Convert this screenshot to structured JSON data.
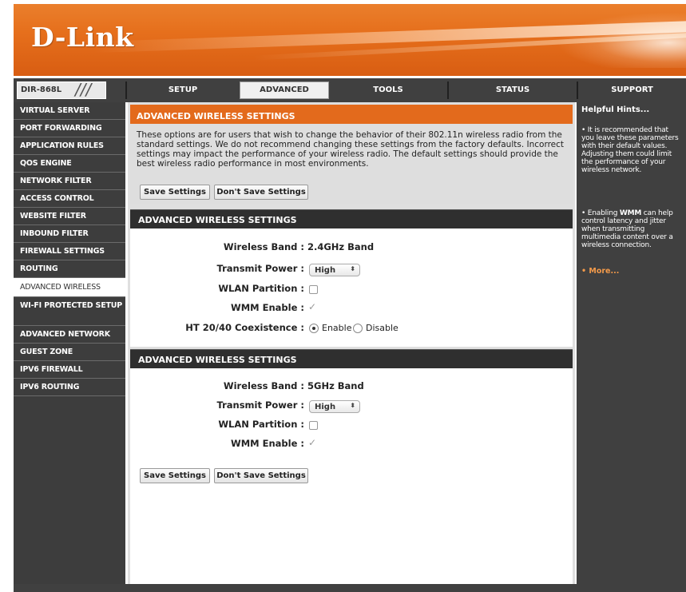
{
  "brand": {
    "logo_text": "D-Link"
  },
  "model": {
    "label": "DIR-868L",
    "slashes": "///"
  },
  "tabs": [
    {
      "label": "SETUP",
      "active": false
    },
    {
      "label": "ADVANCED",
      "active": true
    },
    {
      "label": "TOOLS",
      "active": false
    },
    {
      "label": "STATUS",
      "active": false
    },
    {
      "label": "SUPPORT",
      "active": false
    }
  ],
  "sidebar": {
    "items": [
      {
        "label": "VIRTUAL SERVER"
      },
      {
        "label": "PORT FORWARDING"
      },
      {
        "label": "APPLICATION RULES"
      },
      {
        "label": "QOS ENGINE"
      },
      {
        "label": "NETWORK FILTER"
      },
      {
        "label": "ACCESS CONTROL"
      },
      {
        "label": "WEBSITE FILTER"
      },
      {
        "label": "INBOUND FILTER"
      },
      {
        "label": "FIREWALL SETTINGS"
      },
      {
        "label": "ROUTING"
      },
      {
        "label": "ADVANCED WIRELESS",
        "active": true
      },
      {
        "label": "WI-FI PROTECTED SETUP"
      },
      {
        "label": "ADVANCED NETWORK"
      },
      {
        "label": "GUEST ZONE"
      },
      {
        "label": "IPV6 FIREWALL"
      },
      {
        "label": "IPV6 ROUTING"
      }
    ]
  },
  "intro": {
    "title": "ADVANCED WIRELESS SETTINGS",
    "text": "These options are for users that wish to change the behavior of their 802.11n wireless radio from the standard settings. We do not recommend changing these settings from the factory defaults. Incorrect settings may impact the performance of your wireless radio. The default settings should provide the best wireless radio performance in most environments.",
    "save_label": "Save Settings",
    "dont_save_label": "Don't Save Settings"
  },
  "band24": {
    "title": "ADVANCED WIRELESS SETTINGS",
    "wireless_band_label": "Wireless Band :",
    "wireless_band_value": "2.4GHz Band",
    "transmit_power_label": "Transmit Power :",
    "transmit_power_value": "High",
    "wlan_partition_label": "WLAN Partition :",
    "wlan_partition_checked": false,
    "wmm_label": "WMM Enable :",
    "wmm_checked": true,
    "coexistence_label": "HT 20/40 Coexistence :",
    "coexistence_enable": "Enable",
    "coexistence_disable": "Disable",
    "coexistence_value": "Enable"
  },
  "band5": {
    "title": "ADVANCED WIRELESS SETTINGS",
    "wireless_band_label": "Wireless Band :",
    "wireless_band_value": "5GHz Band",
    "transmit_power_label": "Transmit Power :",
    "transmit_power_value": "High",
    "wlan_partition_label": "WLAN Partition :",
    "wlan_partition_checked": false,
    "wmm_label": "WMM Enable :",
    "wmm_checked": true
  },
  "footer_buttons": {
    "save_label": "Save Settings",
    "dont_save_label": "Don't Save Settings"
  },
  "hints": {
    "title": "Helpful Hints...",
    "hint1": "It is recommended that you leave these parameters with their default values. Adjusting them could limit the performance of your wireless network.",
    "hint2_prefix": "Enabling ",
    "hint2_bold": "WMM",
    "hint2_suffix": " can help control latency and jitter when transmitting multimedia content over a wireless connection.",
    "more": "More..."
  },
  "icons": {
    "checkmark": "checkmark-icon",
    "select_arrows": "updown-arrow-icon",
    "bullet": "bullet-icon"
  },
  "colors": {
    "orange": "#e36a1c",
    "dark": "#404040",
    "link": "#f39a4a"
  }
}
